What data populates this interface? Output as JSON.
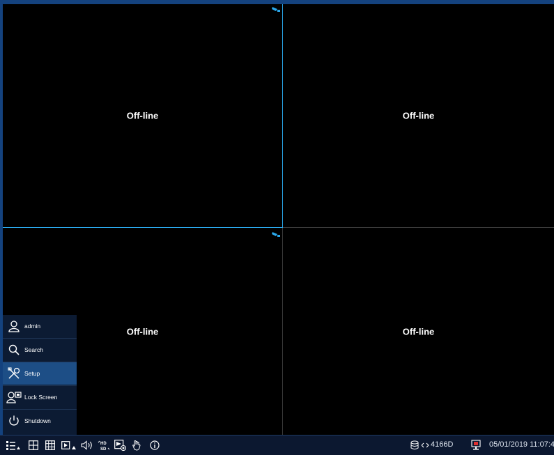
{
  "cameras": [
    {
      "status": "Off-line"
    },
    {
      "status": "Off-line"
    },
    {
      "status": "Off-line"
    },
    {
      "status": "Off-line"
    }
  ],
  "menu": {
    "items": [
      {
        "label": "admin",
        "icon": "user-icon"
      },
      {
        "label": "Search",
        "icon": "search-icon"
      },
      {
        "label": "Setup",
        "icon": "tools-icon",
        "active": true
      },
      {
        "label": "Lock Screen",
        "icon": "lock-screen-icon"
      },
      {
        "label": "Shutdown",
        "icon": "power-icon"
      }
    ]
  },
  "taskbar": {
    "device_id": "4166D",
    "datetime": "05/01/2019 11:07:4",
    "icons": [
      "main-menu-icon",
      "split-4-icon",
      "split-9-icon",
      "sequence-icon",
      "volume-icon",
      "hd-sd-icon",
      "record-icon",
      "ptz-hand-icon",
      "info-icon",
      "hdd-network-icon",
      "alarm-icon"
    ]
  },
  "colors": {
    "selection": "#2aa7ea",
    "menu_active": "#1d4e86",
    "frame": "#14427e",
    "alarm_red": "#e03030"
  }
}
